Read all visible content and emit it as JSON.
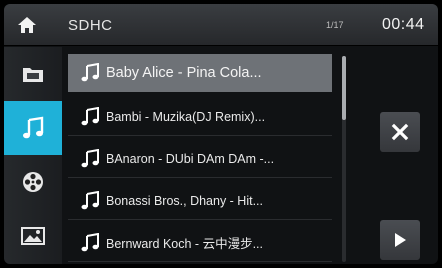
{
  "topbar": {
    "source": "SDHC",
    "track_count": "1/17",
    "clock": "00:44"
  },
  "icons": {
    "home": "home-icon",
    "sidebar": [
      "folder-icon",
      "music-note-icon",
      "reel-icon",
      "image-icon"
    ],
    "close": "close-icon",
    "play": "play-icon"
  },
  "colors": {
    "accent": "#1fb1d8",
    "selected_row": "#6e7277"
  },
  "tracks": [
    {
      "label": "Baby Alice - Pina Cola..."
    },
    {
      "label": "Bambi - Muzika(DJ Remix)..."
    },
    {
      "label": "BAnaron - DUbi DAm DAm -..."
    },
    {
      "label": "Bonassi Bros., Dhany - Hit..."
    },
    {
      "label": "Bernward Koch - 云中漫步..."
    }
  ]
}
